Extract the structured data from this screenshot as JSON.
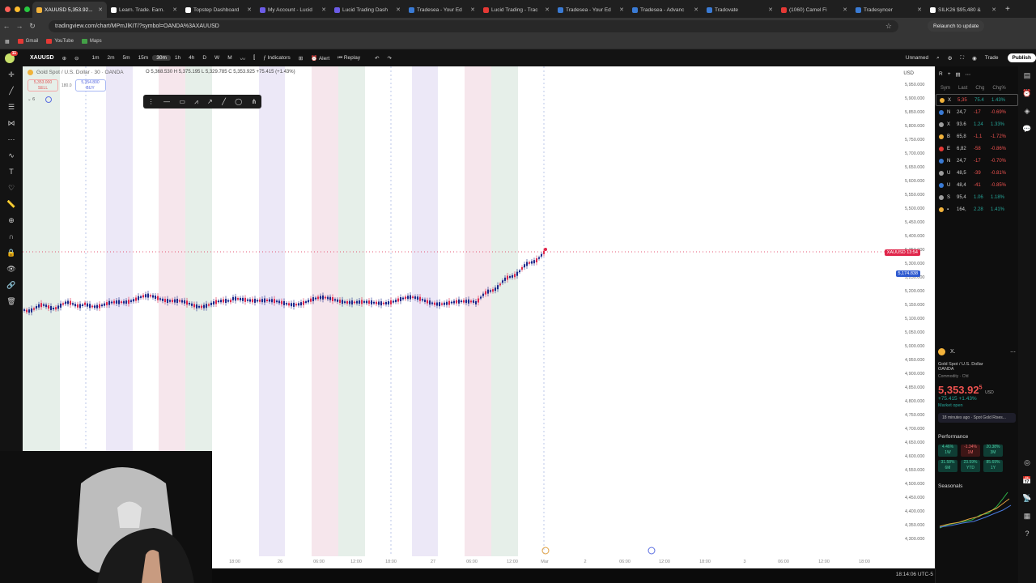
{
  "browser": {
    "tabs": [
      {
        "label": "XAUUSD 5,353.92...",
        "color": "#f3b33b",
        "active": true
      },
      {
        "label": "Learn. Trade. Earn.",
        "color": "#ffffff",
        "active": false
      },
      {
        "label": "Topstep Dashboard",
        "color": "#ffffff",
        "active": false
      },
      {
        "label": "My Account - Lucid",
        "color": "#6c5ce7",
        "active": false
      },
      {
        "label": "Lucid Trading Dash",
        "color": "#6c5ce7",
        "active": false
      },
      {
        "label": "Tradesea - Your Ed",
        "color": "#3a7bd5",
        "active": false
      },
      {
        "label": "Lucid Trading - Trac",
        "color": "#e53935",
        "active": false
      },
      {
        "label": "Tradesea - Your Ed",
        "color": "#3a7bd5",
        "active": false
      },
      {
        "label": "Tradesea - Advanc",
        "color": "#3a7bd5",
        "active": false
      },
      {
        "label": "Tradovate",
        "color": "#3a7bd5",
        "active": false
      },
      {
        "label": "(1060) Camel Fi",
        "color": "#e53935",
        "active": false
      },
      {
        "label": "Tradesyncer",
        "color": "#3a7bd5",
        "active": false
      },
      {
        "label": "SILK26 $95,480 &",
        "color": "#ffffff",
        "active": false
      }
    ],
    "url": "tradingview.com/chart/MPmJlKIT/?symbol=OANDA%3AXAUUSD",
    "relaunch_label": "Relaunch to update",
    "bookmarks": [
      {
        "label": "Gmail",
        "color": "#e53935"
      },
      {
        "label": "YouTube",
        "color": "#e53935"
      },
      {
        "label": "Maps",
        "color": "#43a047"
      }
    ]
  },
  "toolbar": {
    "symbol": "XAUUSD",
    "timeframes": [
      "1m",
      "2m",
      "5m",
      "15m",
      "30m",
      "1h",
      "4h",
      "D",
      "W",
      "M"
    ],
    "active_timeframe": "30m",
    "indicators_label": "Indicators",
    "alert_label": "Alert",
    "replay_label": "Replay",
    "unnamed_label": "Unnamed",
    "trade_label": "Trade",
    "publish_label": "Publish"
  },
  "chart": {
    "legend_title": "Gold Spot / U.S. Dollar · 30 · OANDA",
    "ohlc": "O 5,368.530  H 5,375.195  L 5,329.785  C 5,353.925 +75.415 (+1.43%)",
    "sell_price": "5,353.000",
    "sell_label": "SELL",
    "spread": "180.0",
    "buy_price": "5,354.800",
    "buy_label": "BUY",
    "indicator_count": "6",
    "currency": "USD",
    "symbol_tag": "XAUUSD  13:54",
    "price_tag": "5,174.838",
    "time_labels": [
      "18:00",
      "26",
      "06:00",
      "12:00",
      "18:00",
      "27",
      "06:00",
      "12:00",
      "Mar",
      "2",
      "06:00",
      "12:00",
      "18:00",
      "3",
      "06:00",
      "12:00",
      "18:00"
    ],
    "price_labels": [
      "5,950.000",
      "5,900.000",
      "5,850.000",
      "5,800.000",
      "5,750.000",
      "5,700.000",
      "5,650.000",
      "5,600.000",
      "5,550.000",
      "5,500.000",
      "5,450.000",
      "5,400.000",
      "5,350.000",
      "5,300.000",
      "5,250.000",
      "5,200.000",
      "5,150.000",
      "5,100.000",
      "5,050.000",
      "5,000.000",
      "4,950.000",
      "4,900.000",
      "4,850.000",
      "4,800.000",
      "4,750.000",
      "4,700.000",
      "4,650.000",
      "4,600.000",
      "4,550.000",
      "4,500.000",
      "4,450.000",
      "4,400.000",
      "4,350.000",
      "4,300.000"
    ],
    "clock": "18:14:06 UTC-5",
    "colors": {
      "up": "#1d2a8a",
      "down": "#e0264b",
      "band_green": "#e6efe9",
      "band_purple": "#ece8f7",
      "band_pink": "#f6e6ec"
    }
  },
  "watchlist": {
    "header": "R",
    "columns": [
      "Sym",
      "Last",
      "Chg",
      "Chg%"
    ],
    "rows": [
      {
        "sym": "X",
        "last": "5,35",
        "chg": "75.4",
        "chgp": "1.43%",
        "dir": "pos",
        "color": "#f3b33b"
      },
      {
        "sym": "N",
        "last": "24,7",
        "chg": "-17",
        "chgp": "-0.69%",
        "dir": "neg",
        "color": "#3a7bd5"
      },
      {
        "sym": "X",
        "last": "93.6",
        "chg": "1.24",
        "chgp": "1.33%",
        "dir": "pos",
        "color": "#9e9e9e"
      },
      {
        "sym": "B",
        "last": "65,8",
        "chg": "-1,1",
        "chgp": "-1.72%",
        "dir": "neg",
        "color": "#f3b33b"
      },
      {
        "sym": "E",
        "last": "6,82",
        "chg": "-58",
        "chgp": "-0.86%",
        "dir": "neg",
        "color": "#e53935"
      },
      {
        "sym": "N",
        "last": "24,7",
        "chg": "-17",
        "chgp": "-0.70%",
        "dir": "neg",
        "color": "#3a7bd5"
      },
      {
        "sym": "U",
        "last": "48,5",
        "chg": "-39",
        "chgp": "-0.81%",
        "dir": "neg",
        "color": "#9e9e9e"
      },
      {
        "sym": "U",
        "last": "48,4",
        "chg": "-41",
        "chgp": "-0.85%",
        "dir": "neg",
        "color": "#3a7bd5"
      },
      {
        "sym": "S",
        "last": "95,4",
        "chg": "1.06",
        "chgp": "1.18%",
        "dir": "pos",
        "color": "#9e9e9e"
      },
      {
        "sym": "▪",
        "last": "164,",
        "chg": "2.28",
        "chgp": "1.41%",
        "dir": "pos",
        "color": "#f3b33b"
      }
    ]
  },
  "detail": {
    "name": "Gold Spot / U.S. Dollar",
    "exchange": "OANDA",
    "category": "Commodity · Cfd",
    "price": "5,353.92",
    "price_sup": "5",
    "currency": "USD",
    "change": "+75.415 +1.43%",
    "market_status": "Market open",
    "news": "18 minutes ago · Spot Gold Rises...",
    "performance_title": "Performance",
    "performance": [
      {
        "value": "4.46%",
        "period": "1W",
        "dir": "g"
      },
      {
        "value": "-1.34%",
        "period": "1M",
        "dir": "r"
      },
      {
        "value": "20.38%",
        "period": "3M",
        "dir": "g"
      },
      {
        "value": "31.58%",
        "period": "6M",
        "dir": "g"
      },
      {
        "value": "23.59%",
        "period": "YTD",
        "dir": "g"
      },
      {
        "value": "85.69%",
        "period": "1Y",
        "dir": "g"
      }
    ],
    "seasonals_title": "Seasonals"
  }
}
